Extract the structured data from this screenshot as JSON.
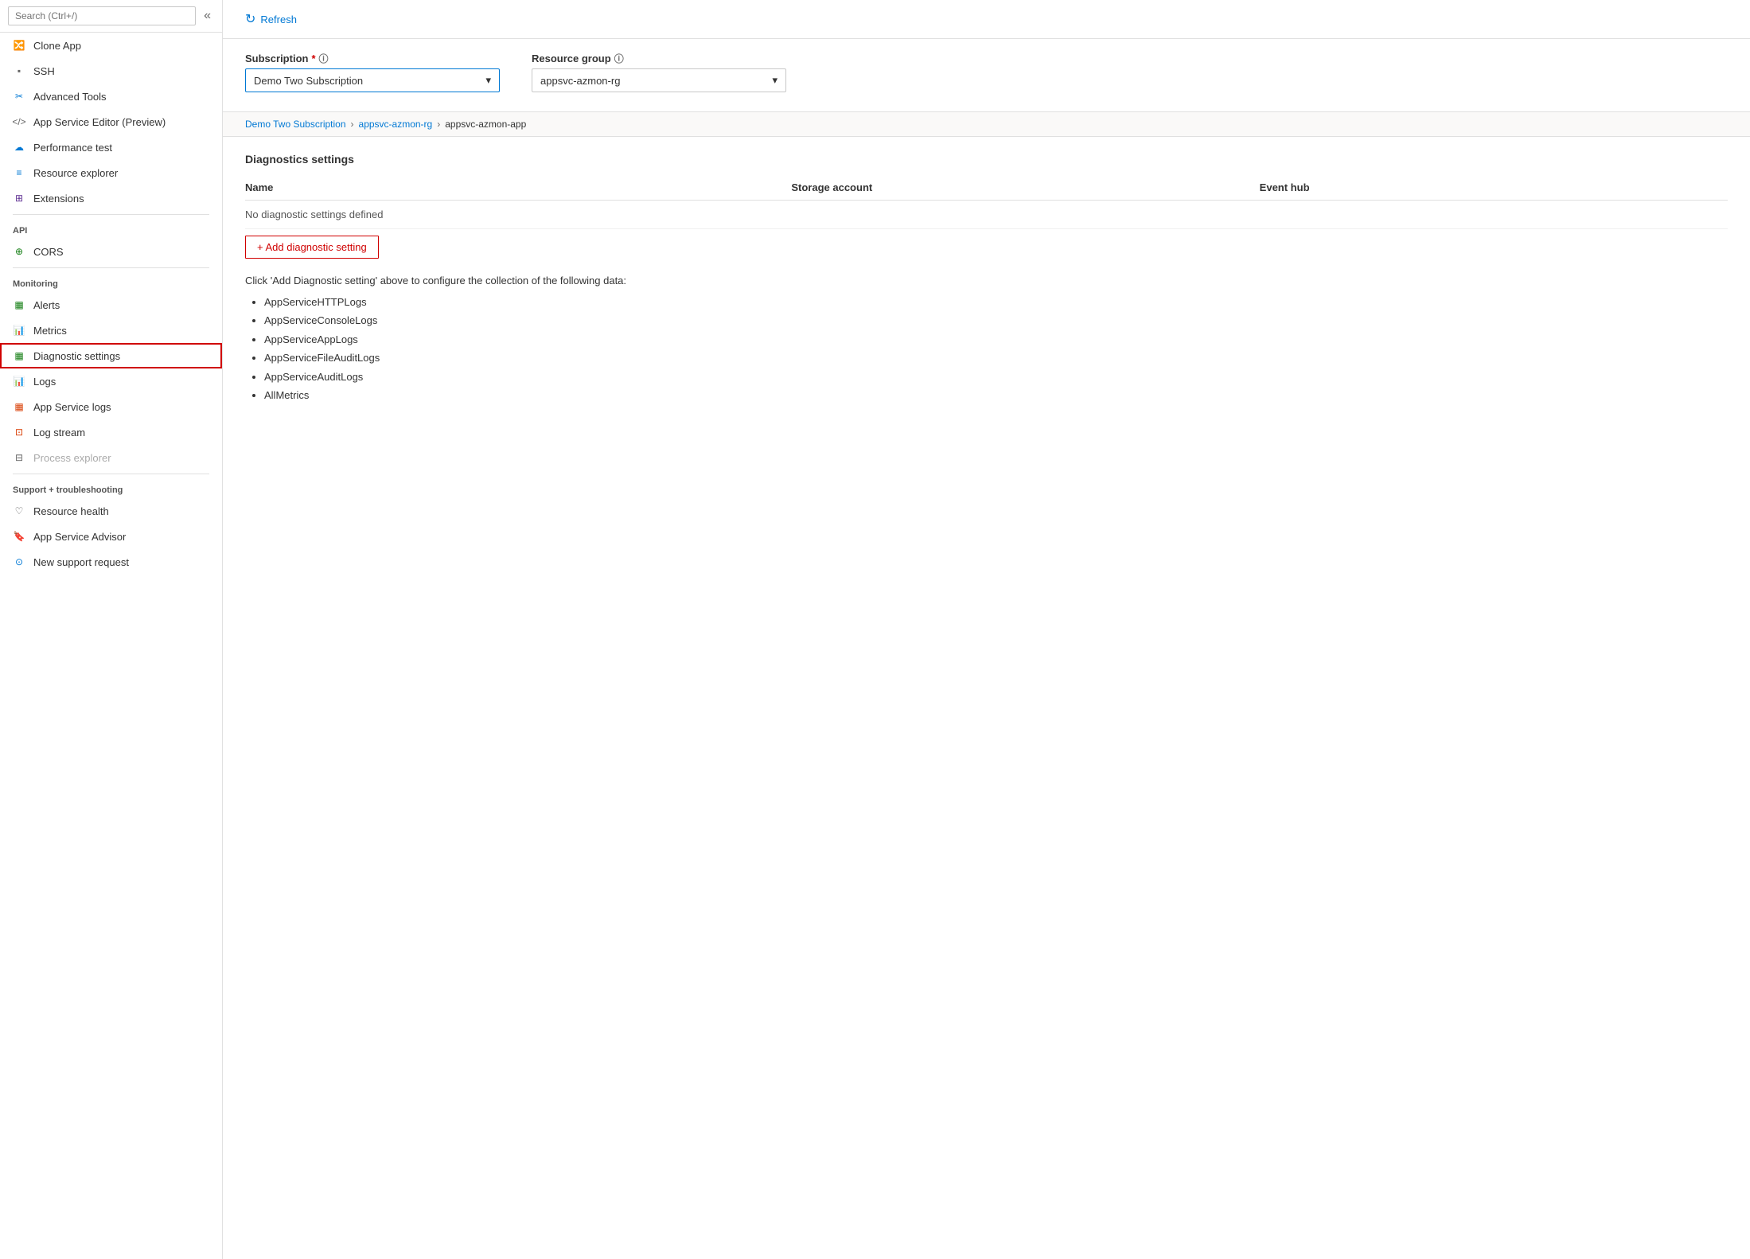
{
  "sidebar": {
    "search_placeholder": "Search (Ctrl+/)",
    "collapse_icon": "«",
    "items": [
      {
        "id": "clone-app",
        "label": "Clone App",
        "icon": "🔀",
        "icon_color": "icon-teal",
        "section": null,
        "disabled": false
      },
      {
        "id": "ssh",
        "label": "SSH",
        "icon": "▪",
        "icon_color": "icon-gray",
        "disabled": false
      },
      {
        "id": "advanced-tools",
        "label": "Advanced Tools",
        "icon": "✂",
        "icon_color": "icon-blue",
        "disabled": false
      },
      {
        "id": "app-service-editor",
        "label": "App Service Editor (Preview)",
        "icon": "</>",
        "icon_color": "icon-gray",
        "disabled": false
      },
      {
        "id": "performance-test",
        "label": "Performance test",
        "icon": "☁",
        "icon_color": "icon-blue",
        "disabled": false
      },
      {
        "id": "resource-explorer",
        "label": "Resource explorer",
        "icon": "≡",
        "icon_color": "icon-blue",
        "disabled": false
      },
      {
        "id": "extensions",
        "label": "Extensions",
        "icon": "⊞",
        "icon_color": "icon-purple",
        "disabled": false
      }
    ],
    "sections": [
      {
        "label": "API",
        "items": [
          {
            "id": "cors",
            "label": "CORS",
            "icon": "⊕",
            "icon_color": "icon-green",
            "disabled": false
          }
        ]
      },
      {
        "label": "Monitoring",
        "items": [
          {
            "id": "alerts",
            "label": "Alerts",
            "icon": "▦",
            "icon_color": "icon-green",
            "disabled": false
          },
          {
            "id": "metrics",
            "label": "Metrics",
            "icon": "📊",
            "icon_color": "icon-blue",
            "disabled": false
          },
          {
            "id": "diagnostic-settings",
            "label": "Diagnostic settings",
            "icon": "▦",
            "icon_color": "icon-green",
            "disabled": false,
            "active": true
          },
          {
            "id": "logs",
            "label": "Logs",
            "icon": "📊",
            "icon_color": "icon-blue",
            "disabled": false
          },
          {
            "id": "app-service-logs",
            "label": "App Service logs",
            "icon": "▦",
            "icon_color": "icon-orange",
            "disabled": false
          },
          {
            "id": "log-stream",
            "label": "Log stream",
            "icon": "⊡",
            "icon_color": "icon-orange",
            "disabled": false
          },
          {
            "id": "process-explorer",
            "label": "Process explorer",
            "icon": "⊟",
            "icon_color": "icon-gray",
            "disabled": true
          }
        ]
      },
      {
        "label": "Support + troubleshooting",
        "items": [
          {
            "id": "resource-health",
            "label": "Resource health",
            "icon": "♡",
            "icon_color": "icon-gray",
            "disabled": false
          },
          {
            "id": "app-service-advisor",
            "label": "App Service Advisor",
            "icon": "🔖",
            "icon_color": "icon-blue",
            "disabled": false
          },
          {
            "id": "new-support-request",
            "label": "New support request",
            "icon": "⊙",
            "icon_color": "icon-blue",
            "disabled": false
          }
        ]
      }
    ]
  },
  "toolbar": {
    "refresh_label": "Refresh",
    "refresh_icon": "↻"
  },
  "subscription_field": {
    "label": "Subscription",
    "required": true,
    "value": "Demo Two Subscription",
    "dropdown_icon": "▾"
  },
  "resource_group_field": {
    "label": "Resource group",
    "value": "appsvc-azmon-rg",
    "dropdown_icon": "▾"
  },
  "breadcrumb": {
    "items": [
      {
        "id": "sub",
        "label": "Demo Two Subscription",
        "link": true
      },
      {
        "id": "rg",
        "label": "appsvc-azmon-rg",
        "link": true
      },
      {
        "id": "app",
        "label": "appsvc-azmon-app",
        "link": false
      }
    ]
  },
  "diagnostics": {
    "section_title": "Diagnostics settings",
    "table": {
      "columns": [
        "Name",
        "Storage account",
        "Event hub"
      ],
      "empty_message": "No diagnostic settings defined"
    },
    "add_button_label": "+ Add diagnostic setting",
    "instruction": "Click 'Add Diagnostic setting' above to configure the collection of the following data:",
    "data_items": [
      "AppServiceHTTPLogs",
      "AppServiceConsoleLogs",
      "AppServiceAppLogs",
      "AppServiceFileAuditLogs",
      "AppServiceAuditLogs",
      "AllMetrics"
    ]
  }
}
